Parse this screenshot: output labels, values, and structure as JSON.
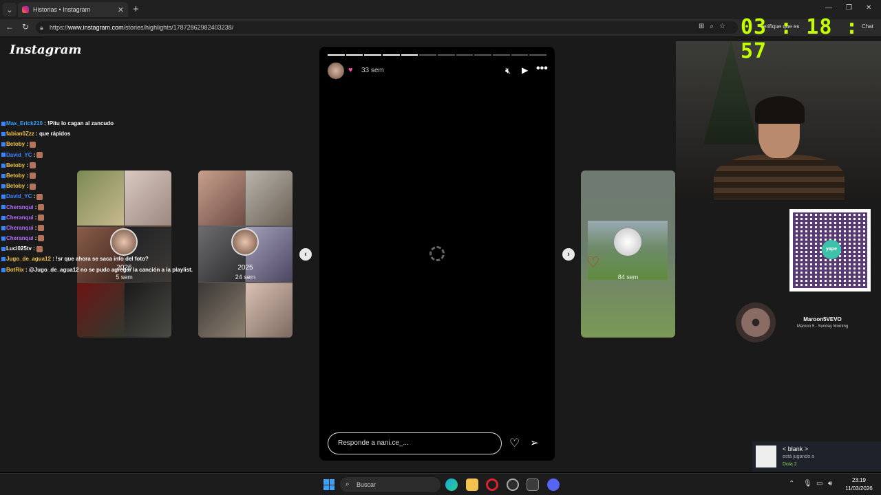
{
  "browser": {
    "tab_title": "Historias • Instagram",
    "url_prefix": "https://",
    "url_host": "www.instagram.com",
    "url_path": "/stories/highlights/17872862982403238/",
    "verify_text": "Verifique que es",
    "chat_label": "Chat"
  },
  "instagram": {
    "logo": "Instagram",
    "left_card_1": {
      "label": "2026",
      "sub": "5 sem"
    },
    "left_card_2": {
      "label": "2025",
      "sub": "24 sem"
    },
    "right_card": {
      "sub": "84 sem"
    },
    "story": {
      "time": "33 sem",
      "progress_total": 12,
      "progress_done": 5,
      "reply_placeholder": "Responde a nani.ce_..."
    }
  },
  "chat": [
    {
      "user": "Max_Erick210",
      "color": "#3aa0ff",
      "msg": ": !Pitu lo cagan al zancudo"
    },
    {
      "user": "fabian0Zzz",
      "color": "#f4c542",
      "msg": ": que rápidos"
    },
    {
      "user": "Betoby",
      "color": "#f4c542",
      "msg": ":"
    },
    {
      "user": "David_YC",
      "color": "#3a86ff",
      "msg": ":"
    },
    {
      "user": "Betoby",
      "color": "#f4c542",
      "msg": ":"
    },
    {
      "user": "Betoby",
      "color": "#f4c542",
      "msg": ":"
    },
    {
      "user": "Betoby",
      "color": "#f4c542",
      "msg": ":"
    },
    {
      "user": "David_YC",
      "color": "#3a86ff",
      "msg": ":"
    },
    {
      "user": "Cheranqui",
      "color": "#b06cff",
      "msg": ":"
    },
    {
      "user": "Cheranqui",
      "color": "#b06cff",
      "msg": ":"
    },
    {
      "user": "Cheranqui",
      "color": "#b06cff",
      "msg": ":"
    },
    {
      "user": "Cheranqui",
      "color": "#b06cff",
      "msg": ":"
    },
    {
      "user": "Luci025tv",
      "color": "#ffffff",
      "msg": ":"
    },
    {
      "user": "Jugo_de_agua12",
      "color": "#f4c542",
      "msg": ": !sr que ahora se saca info del foto?"
    },
    {
      "user": "BotRix",
      "color": "#f4c542",
      "msg": ": @Jugo_de_agua12 no se pudo agregar la canción a la playlist."
    }
  ],
  "overlay": {
    "timer": "03 : 18 : 57",
    "qr_logo": "yape",
    "music_artist": "Maroon5VEVO",
    "music_song": "Maroon 5 - Sunday Morning"
  },
  "game_toast": {
    "name": "< blank >",
    "status": "está jugando a",
    "game": "Dota 2"
  },
  "taskbar": {
    "search_placeholder": "Buscar",
    "time": "23:19",
    "date": "11/03/2026"
  }
}
